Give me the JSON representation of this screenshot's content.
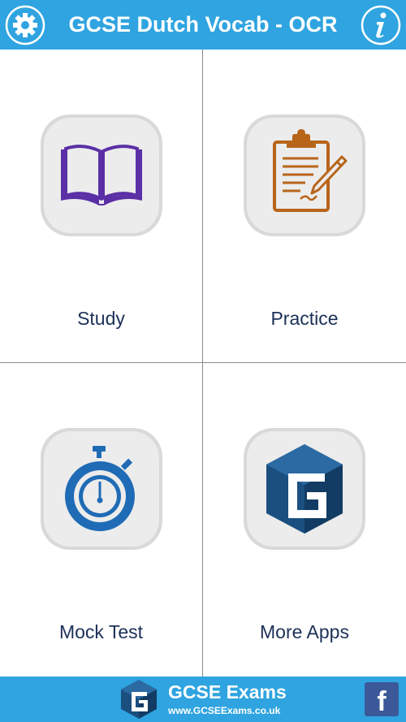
{
  "header": {
    "title": "GCSE Dutch Vocab - OCR",
    "settings_icon": "gear-icon",
    "info_icon": "info-icon"
  },
  "menu": [
    {
      "label": "Study",
      "icon": "open-book-icon"
    },
    {
      "label": "Practice",
      "icon": "clipboard-pen-icon"
    },
    {
      "label": "Mock Test",
      "icon": "stopwatch-icon"
    },
    {
      "label": "More Apps",
      "icon": "gcse-cube-icon"
    }
  ],
  "footer": {
    "brand_name": "GCSE Exams",
    "brand_url": "www.GCSEExams.co.uk",
    "facebook_glyph": "f"
  },
  "colors": {
    "header_bg": "#2fa4e0",
    "label_text": "#1c3058",
    "book": "#5b2fa6",
    "clipboard": "#b8651a",
    "stopwatch": "#1f6bb5",
    "cube": "#1a4f80",
    "facebook": "#3b5998"
  }
}
